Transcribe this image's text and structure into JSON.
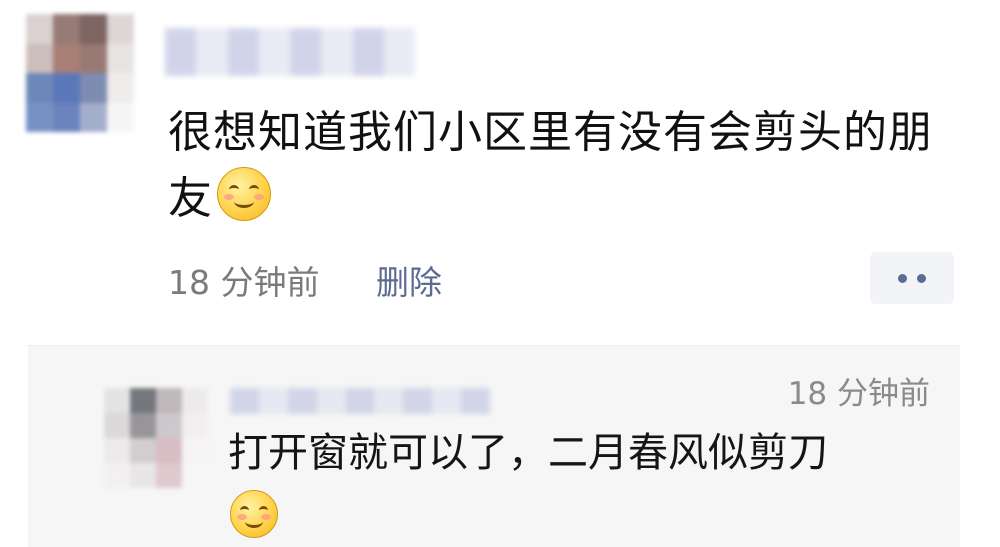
{
  "post": {
    "text": "很想知道我们小区里有没有会剪头的朋友",
    "emoji": "smile-emoji",
    "time": "18 分钟前",
    "delete_label": "删除",
    "more_icon": "more-dots-icon"
  },
  "comment": {
    "time": "18 分钟前",
    "text": "打开窗就可以了，二月春风似剪刀",
    "emoji": "smile-emoji"
  }
}
